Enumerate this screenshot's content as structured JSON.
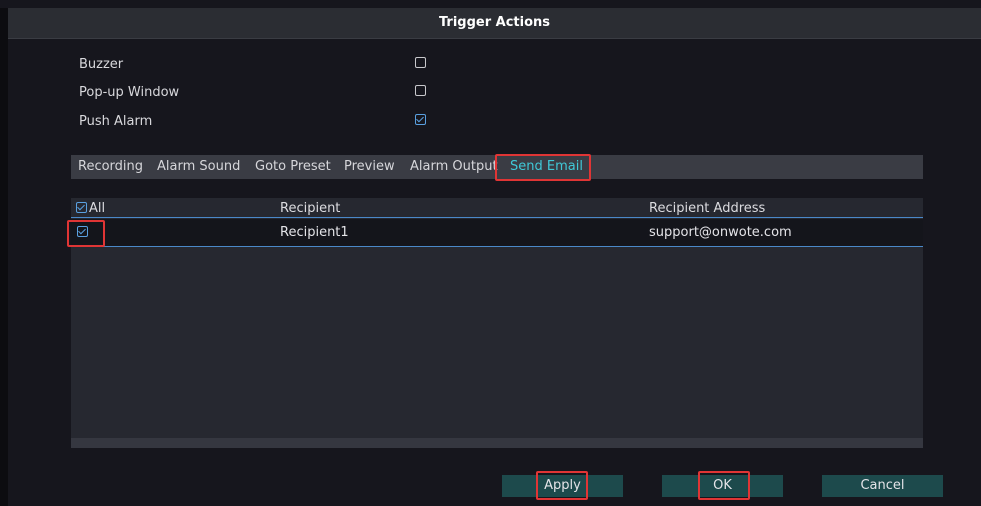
{
  "dialog": {
    "title": "Trigger Actions"
  },
  "options": [
    {
      "label": "Buzzer",
      "checked": false
    },
    {
      "label": "Pop-up Window",
      "checked": false
    },
    {
      "label": "Push Alarm",
      "checked": true
    }
  ],
  "tabs": [
    {
      "label": "Recording",
      "active": false
    },
    {
      "label": "Alarm Sound",
      "active": false
    },
    {
      "label": "Goto Preset",
      "active": false
    },
    {
      "label": "Preview",
      "active": false
    },
    {
      "label": "Alarm Output",
      "active": false
    },
    {
      "label": "Send Email",
      "active": true
    }
  ],
  "table": {
    "columns": [
      "All",
      "Recipient",
      "Recipient Address"
    ],
    "rows": [
      {
        "checked": true,
        "recipient": "Recipient1",
        "address": "support@onwote.com"
      }
    ]
  },
  "buttons": {
    "apply": "Apply",
    "ok": "OK",
    "cancel": "Cancel"
  },
  "colors": {
    "accent": "#40c9d8",
    "highlight": "#e03535",
    "button_bg": "#1d4a4c"
  }
}
